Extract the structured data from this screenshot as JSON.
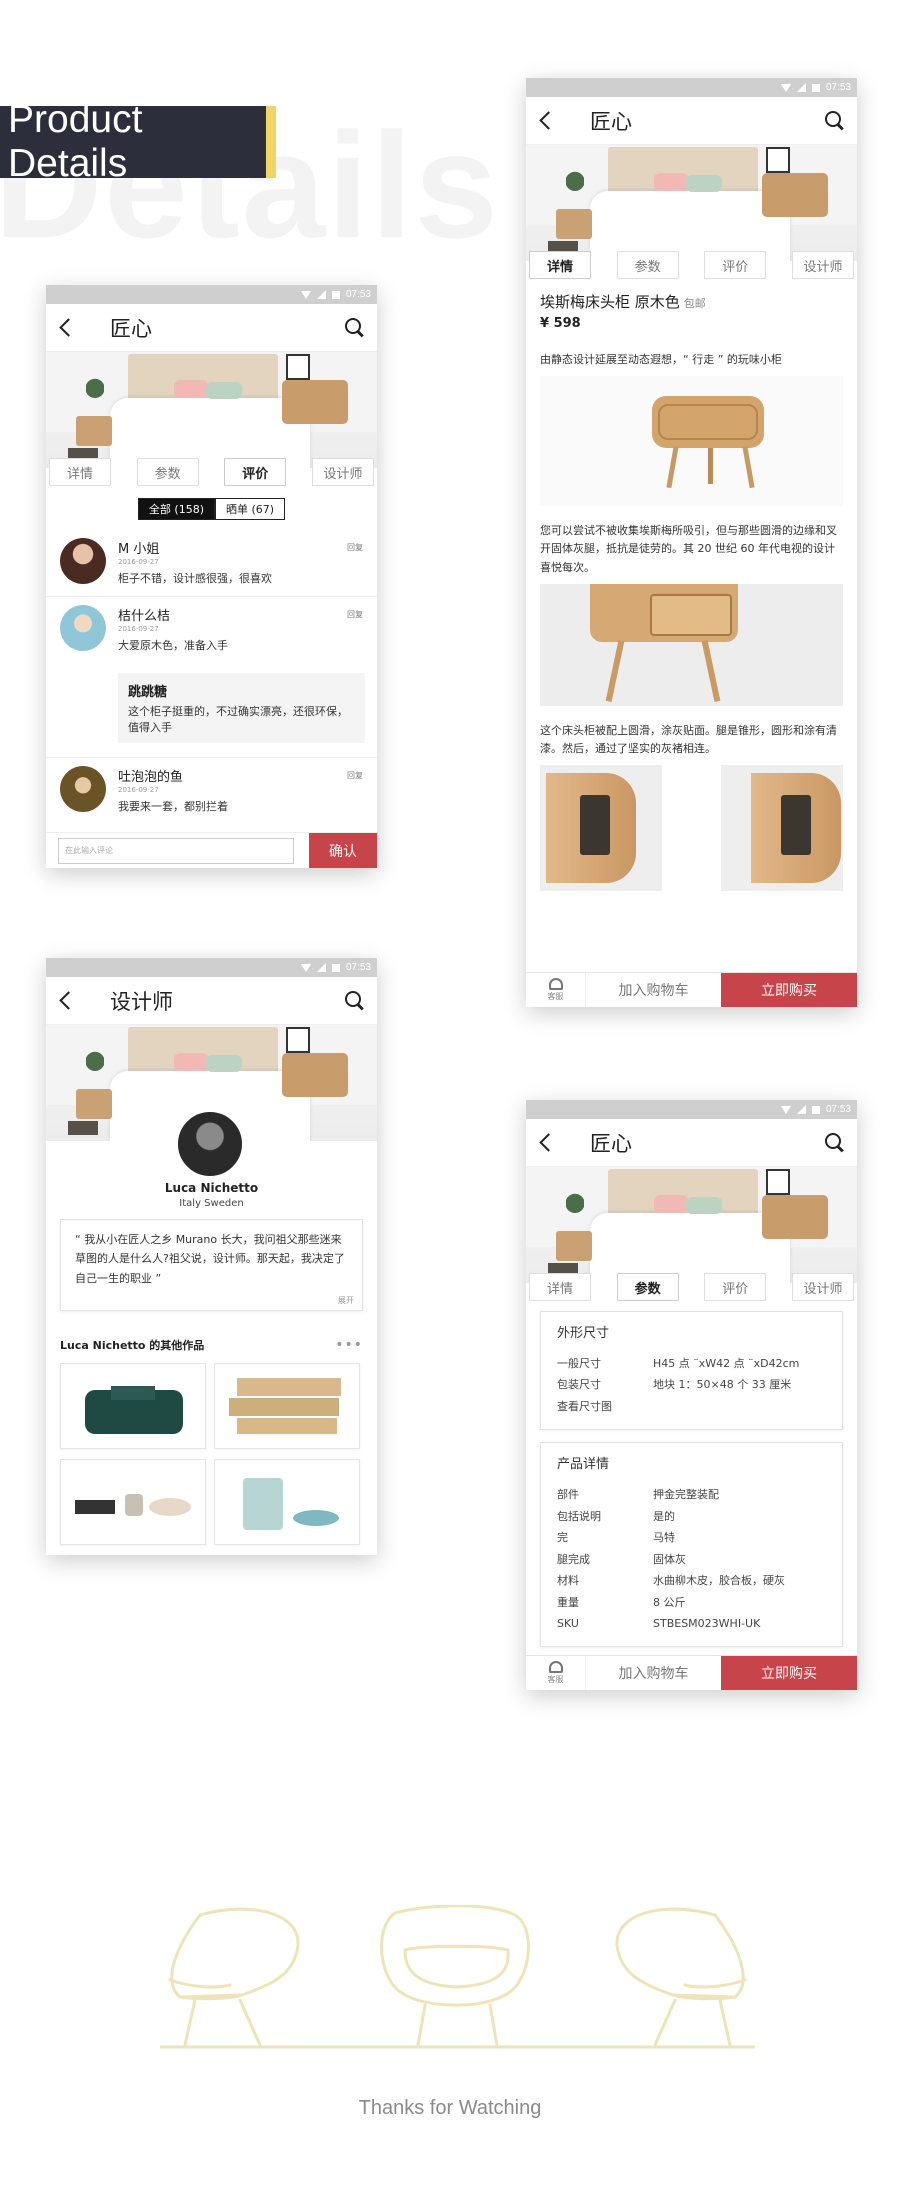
{
  "banner": {
    "title": "Product Details",
    "bg_word": "Details"
  },
  "status": {
    "time": "07:53"
  },
  "brand": "匠心",
  "tabs": [
    "详情",
    "参数",
    "评价",
    "设计师"
  ],
  "bottom": {
    "service": "客服",
    "cart": "加入购物车",
    "buy": "立即购买"
  },
  "reviews_screen": {
    "filters": [
      "全部 (158)",
      "晒单 (67)"
    ],
    "reviews": [
      {
        "name": "M 小姐",
        "date": "2016-09-27",
        "text": "柜子不错，设计感很强，很喜欢",
        "reply": "回复"
      },
      {
        "name": "桔什么桔",
        "date": "2016-09-27",
        "text": "大爱原木色，准备入手",
        "reply": "回复",
        "sub": {
          "name": "跳跳糖",
          "text": "这个柜子挺重的，不过确实漂亮，还很环保，值得入手"
        }
      },
      {
        "name": "吐泡泡的鱼",
        "date": "2016-09-27",
        "text": "我要来一套，都别拦着",
        "reply": "回复"
      }
    ],
    "comment_placeholder": "在此输入评论",
    "confirm": "确认"
  },
  "designer_screen": {
    "title": "设计师",
    "name": "Luca Nichetto",
    "country": "Italy   Sweden",
    "quote": "“ 我从小在匠人之乡 Murano 长大，我问祖父那些迷来草图的人是什么人?祖父说，设计师。那天起，我决定了自己一生的职业 ”",
    "more": "展开",
    "works_title": "Luca Nichetto 的其他作品"
  },
  "details_screen": {
    "product_title": "埃斯梅床头柜 原木色",
    "tag": "包邮",
    "price": "¥ 598",
    "desc1": "由静态设计延展至动态遐想，“ 行走 ” 的玩味小柜",
    "desc2": "您可以尝试不被收集埃斯梅所吸引，但与那些圆滑的边缘和叉开固体灰腿，抵抗是徒劳的。其 20 世纪 60 年代电视的设计喜悦每次。",
    "desc3": "这个床头柜被配上圆滑，涂灰贴面。腿是锥形，圆形和涂有清漆。然后，通过了坚实的灰褚相连。"
  },
  "specs_screen": {
    "dimensions": {
      "title": "外形尺寸",
      "rows": [
        {
          "k": "一般尺寸",
          "v": "H45 点 ¨xW42 点 ¨xD42cm"
        },
        {
          "k": "包装尺寸",
          "v": "地块 1：50×48 个 33 厘米"
        },
        {
          "k": "查看尺寸图",
          "v": ""
        }
      ]
    },
    "product": {
      "title": "产品详情",
      "rows": [
        {
          "k": "部件",
          "v": "押金完整装配"
        },
        {
          "k": "包括说明",
          "v": "是的"
        },
        {
          "k": "完",
          "v": "马特"
        },
        {
          "k": "腿完成",
          "v": "固体灰"
        },
        {
          "k": "材料",
          "v": "水曲柳木皮，胶合板，硬灰"
        },
        {
          "k": "重量",
          "v": "8 公斤"
        },
        {
          "k": "SKU",
          "v": "STBESM023WHI-UK"
        }
      ]
    }
  },
  "footer": {
    "thanks": "Thanks for Watching"
  },
  "colors": {
    "accent_red": "#c8444b",
    "banner_dark": "#2c2f3b",
    "banner_yellow": "#f2d464",
    "chair_line": "#efe3b8"
  }
}
